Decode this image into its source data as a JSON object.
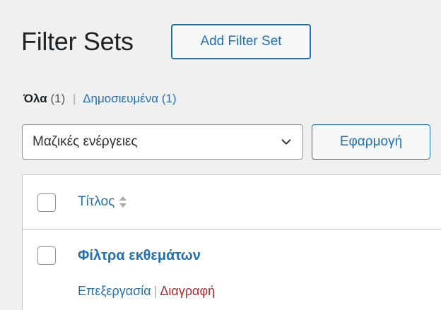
{
  "header": {
    "title": "Filter Sets",
    "add_button_label": "Add Filter Set"
  },
  "views": [
    {
      "label": "Όλα",
      "count": "(1)"
    },
    {
      "label": "Δημοσιευμένα",
      "count": "(1)"
    }
  ],
  "views_separator": "|",
  "bulk_actions": {
    "selected": "Μαζικές ενέργειες",
    "apply_label": "Εφαρμογή"
  },
  "table": {
    "columns": [
      {
        "label": "Τίτλος",
        "sortable": true
      }
    ],
    "rows": [
      {
        "title": "Φίλτρα εκθεμάτων",
        "actions": [
          {
            "label": "Επεξεργασία",
            "type": "edit"
          },
          {
            "label": "Διαγραφή",
            "type": "delete"
          }
        ]
      }
    ],
    "action_separator": "|"
  },
  "colors": {
    "accent": "#2271b1",
    "delete": "#b32d2e",
    "background": "#f0f0f1"
  },
  "icons": {
    "select_chevron": "chevron-down-icon",
    "sort": "sort-arrows-icon"
  }
}
